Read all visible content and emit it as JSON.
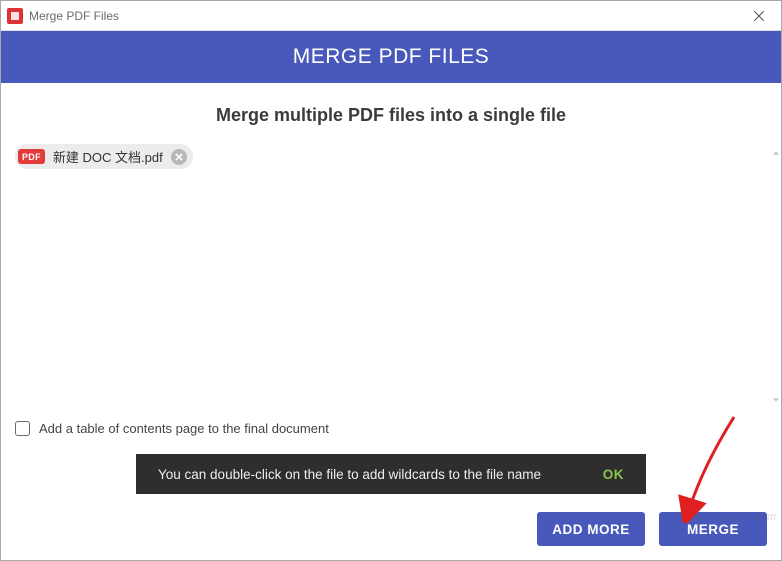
{
  "window": {
    "title": "Merge PDF Files"
  },
  "banner": {
    "title": "MERGE PDF FILES"
  },
  "subtitle": "Merge multiple PDF files into a single file",
  "files": [
    {
      "badge": "PDF",
      "name": "新建 DOC 文档.pdf"
    }
  ],
  "options": {
    "toc_label": "Add a table of contents page to the final document"
  },
  "toast": {
    "message": "You can double-click on the file to add wildcards to the file name",
    "ok": "OK"
  },
  "buttons": {
    "add_more": "ADD MORE",
    "merge": "MERGE"
  },
  "watermark": "www.xiazaiba.com"
}
